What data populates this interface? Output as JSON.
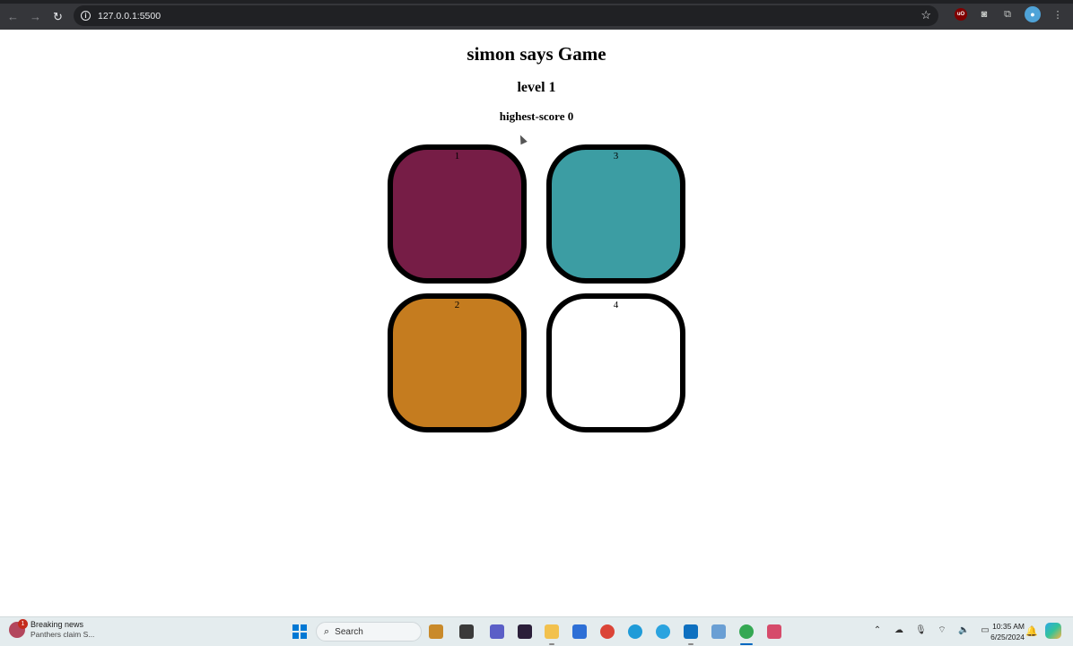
{
  "browser": {
    "url": "127.0.0.1:5500",
    "nav_back_icon": "←",
    "nav_forward_icon": "→",
    "reload_icon": "↻",
    "star_icon": "☆"
  },
  "game": {
    "title": "simon says Game",
    "level": "level 1",
    "highest_score": "highest-score 0",
    "buttons": [
      {
        "label": "1",
        "color": "#761d46"
      },
      {
        "label": "3",
        "color": "#3c9da3"
      },
      {
        "label": "2",
        "color": "#c57c1f"
      },
      {
        "label": "4",
        "color": "#ffffff"
      }
    ]
  },
  "taskbar": {
    "news_title": "Breaking news",
    "news_subtitle": "Panthers claim S...",
    "news_badge": "1",
    "search_label": "Search",
    "time": "10:35 AM",
    "date": "6/25/2024",
    "pinned_apps": [
      "file-explorer",
      "teams",
      "figma",
      "folder",
      "store",
      "chrome",
      "edge",
      "telegram",
      "vscode",
      "notepad",
      "chrome-profile",
      "snipping-tool"
    ]
  }
}
